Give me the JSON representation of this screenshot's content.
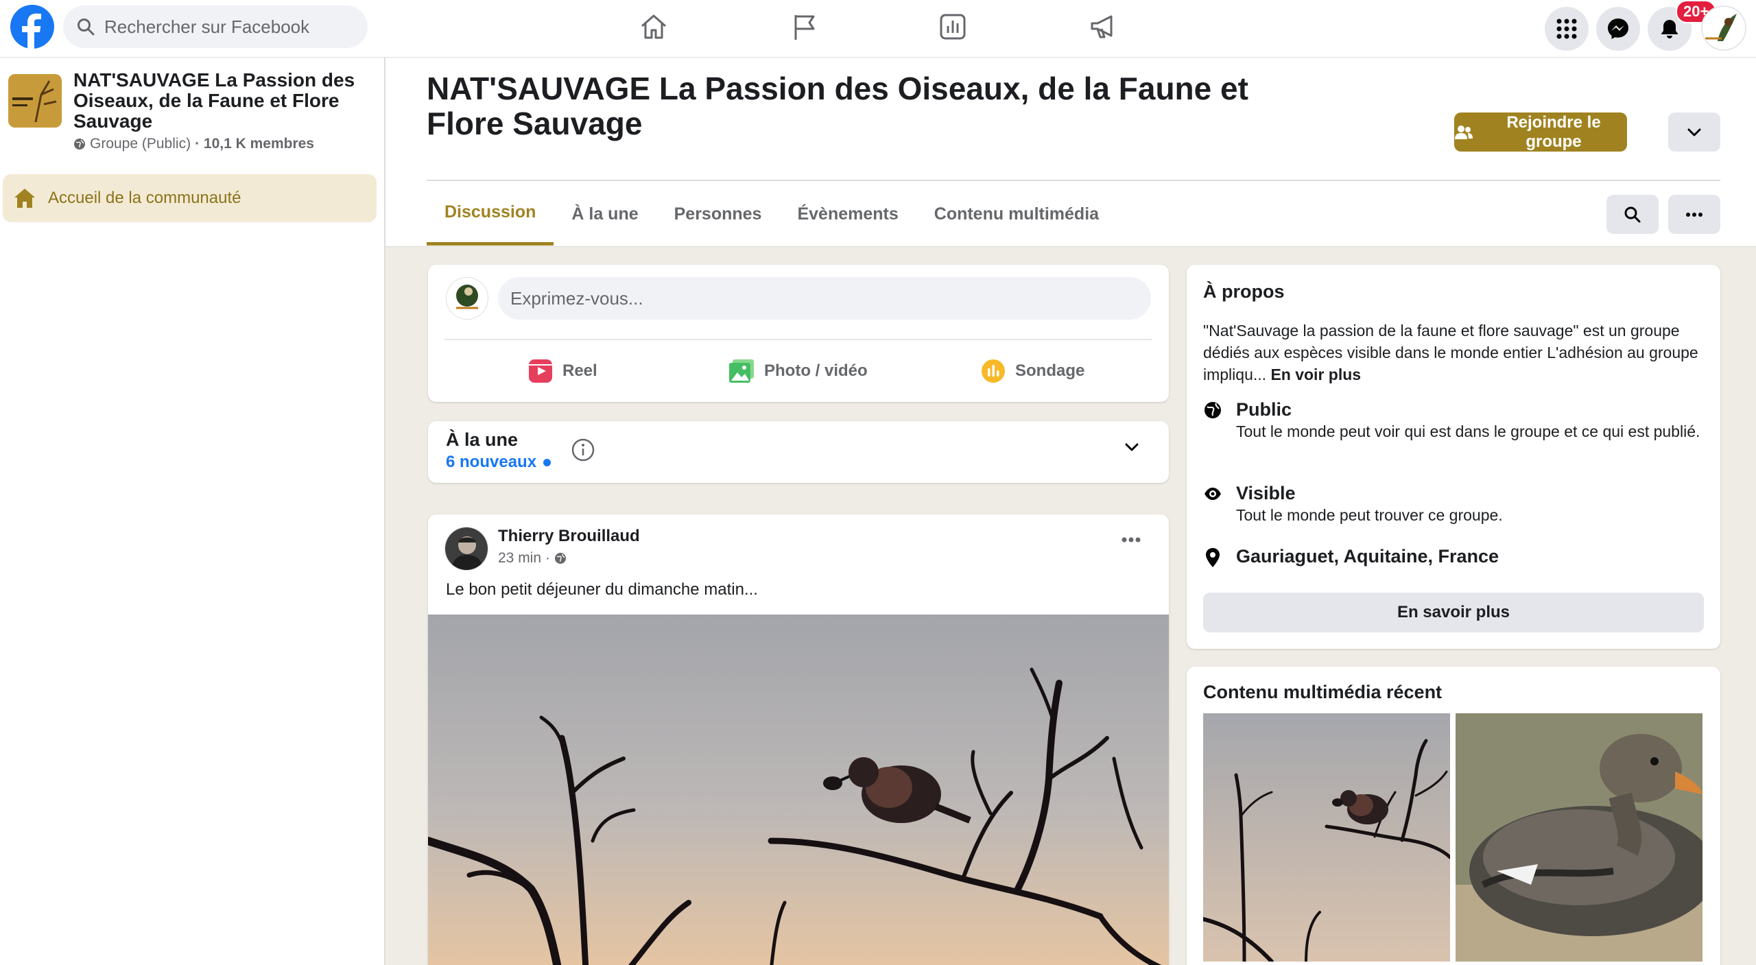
{
  "topbar": {
    "search_placeholder": "Rechercher sur Facebook",
    "notifications_badge": "20+",
    "nav_icons": [
      "home-icon",
      "flag-icon",
      "chart-icon",
      "megaphone-icon"
    ],
    "right_icons": [
      "menu-grid-icon",
      "messenger-icon",
      "bell-icon"
    ]
  },
  "sidebar": {
    "group_name": "NAT'SAUVAGE La Passion des Oiseaux, de la Faune et Flore Sauvage",
    "group_privacy": "Groupe (Public)",
    "group_members": "· 10,1 K membres",
    "community_home": "Accueil de la communauté"
  },
  "header": {
    "title": "NAT'SAUVAGE La Passion des Oiseaux, de la Faune et Flore Sauvage",
    "join_label": "Rejoindre le groupe",
    "tabs": [
      "Discussion",
      "À la une",
      "Personnes",
      "Évènements",
      "Contenu multimédia"
    ],
    "active_tab": "Discussion"
  },
  "composer": {
    "placeholder": "Exprimez-vous...",
    "actions": [
      "Reel",
      "Photo / vidéo",
      "Sondage"
    ],
    "colors": {
      "reel": "#e63f5c",
      "photo": "#45bd62",
      "poll": "#f7b928"
    }
  },
  "featured": {
    "title": "À la une",
    "new_count": "6 nouveaux"
  },
  "post": {
    "author": "Thierry Brouillaud",
    "time": "23 min ·",
    "text": "Le bon petit déjeuner du dimanche matin..."
  },
  "about": {
    "title": "À propos",
    "description": "\"Nat'Sauvage la passion de la faune et flore sauvage\" est un groupe dédiés aux espèces visible dans le monde entier L'adhésion au groupe impliqu...",
    "see_more": "En voir plus",
    "public_title": "Public",
    "public_desc": "Tout le monde peut voir qui est dans le groupe et ce qui est publié.",
    "visible_title": "Visible",
    "visible_desc": "Tout le monde peut trouver ce groupe.",
    "location": "Gauriaguet, Aquitaine, France",
    "learn_more": "En savoir plus"
  },
  "media": {
    "title": "Contenu multimédia récent"
  },
  "colors": {
    "accent": "#a08320",
    "facebook_blue": "#1877f2",
    "badge_red": "#e41e3f"
  }
}
